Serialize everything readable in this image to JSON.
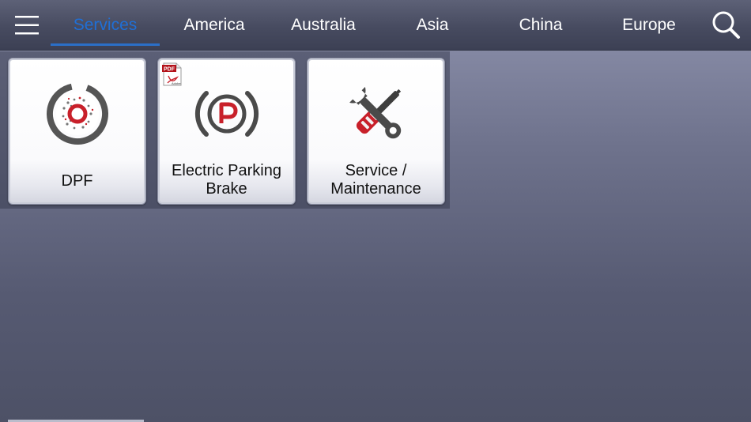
{
  "nav": {
    "tabs": [
      {
        "label": "Services",
        "active": true
      },
      {
        "label": "America",
        "active": false
      },
      {
        "label": "Australia",
        "active": false
      },
      {
        "label": "Asia",
        "active": false
      },
      {
        "label": "China",
        "active": false
      },
      {
        "label": "Europe",
        "active": false
      }
    ],
    "menu_icon": "hamburger-icon",
    "search_icon": "search-icon"
  },
  "tiles": [
    {
      "label": "DPF",
      "icon": "dpf-filter-icon",
      "pdf": false
    },
    {
      "label": "Electric Parking Brake",
      "label_lines": [
        "Electric Parking",
        "Brake"
      ],
      "icon": "parking-brake-icon",
      "pdf": true
    },
    {
      "label": "Service / Maintenance",
      "label_lines": [
        "Service /",
        "Maintenance"
      ],
      "icon": "wrench-screwdriver-icon",
      "pdf": false
    }
  ],
  "pdf_badge": {
    "text": "PDF",
    "sub": "Adobe"
  },
  "colors": {
    "active_tab": "#1f6fd6",
    "accent_red": "#c8202a",
    "icon_gray": "#4a4a4a"
  }
}
